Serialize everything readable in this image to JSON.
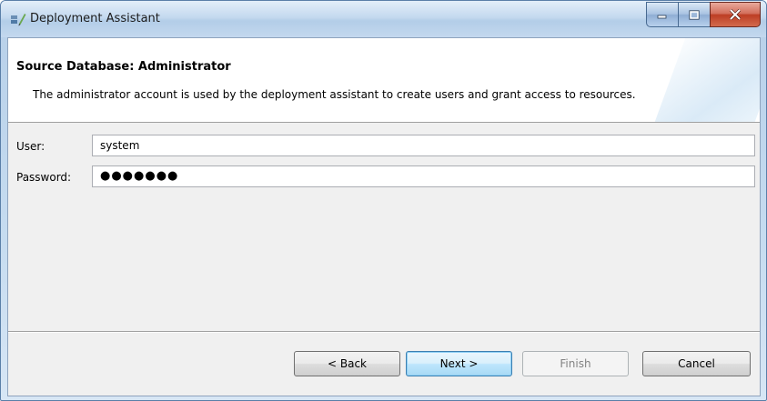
{
  "window": {
    "title": "Deployment Assistant",
    "icon": "deployment-assistant-icon"
  },
  "caption": {
    "minimize_icon": "minimize-icon",
    "maximize_icon": "maximize-icon",
    "close_icon": "close-icon"
  },
  "banner": {
    "title": "Source Database: Administrator",
    "description": "The administrator account is used by the deployment assistant to create users and grant access to resources."
  },
  "form": {
    "user_label": "User:",
    "user_value": "system",
    "password_label": "Password:",
    "password_value": "●●●●●●●"
  },
  "buttons": {
    "back": "< Back",
    "next": "Next >",
    "finish": "Finish",
    "cancel": "Cancel",
    "finish_enabled": false
  },
  "colors": {
    "accent": "#3c7fb1",
    "close_button": "#c74a33",
    "titlebar": "#c4d9ef"
  }
}
